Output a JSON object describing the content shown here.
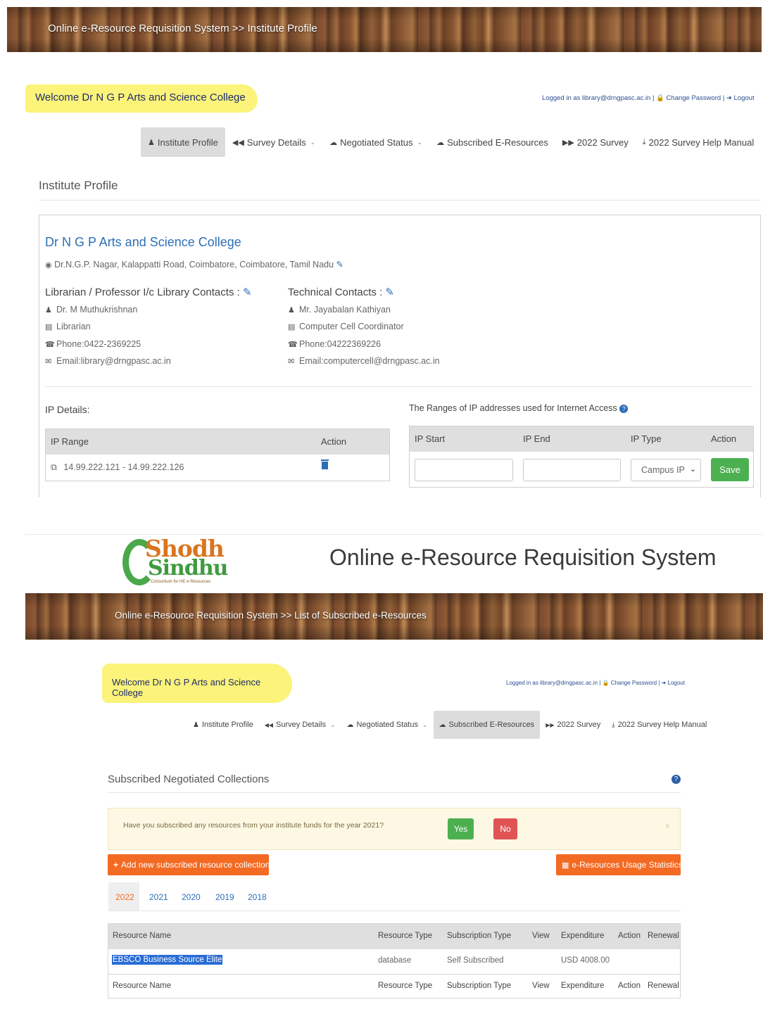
{
  "top": {
    "breadcrumb": "Online e-Resource Requisition System >> Institute Profile",
    "welcome": "Welcome Dr N G P Arts and Science College",
    "logged_in": "Logged in as library@drngpasc.ac.in | 🔒 Change Password | ➜ Logout",
    "nav": [
      {
        "label": "Institute Profile",
        "icon": "user-icon"
      },
      {
        "label": "Survey Details",
        "icon": "backward-icon"
      },
      {
        "label": "Negotiated Status",
        "icon": "cloud-icon"
      },
      {
        "label": "Subscribed E-Resources",
        "icon": "cloud-icon"
      },
      {
        "label": "2022 Survey",
        "icon": "forward-icon"
      },
      {
        "label": "2022 Survey Help Manual",
        "icon": "download-icon"
      }
    ],
    "section_title": "Institute Profile",
    "college_name": "Dr N G P Arts and Science College",
    "address": "Dr.N.G.P. Nagar, Kalappatti Road, Coimbatore, Coimbatore, Tamil Nadu",
    "librarian": {
      "heading": "Librarian / Professor I/c Library Contacts :",
      "name": "Dr. M Muthukrishnan",
      "designation": "Librarian",
      "phone": "Phone:0422-2369225",
      "email": "Email:library@drngpasc.ac.in"
    },
    "technical": {
      "heading": "Technical Contacts :",
      "name": "Mr. Jayabalan Kathiyan",
      "designation": "Computer Cell Coordinator",
      "phone": "Phone:04222369226",
      "email": "Email:computercell@drngpasc.ac.in"
    },
    "ip_details_label": "IP Details:",
    "ip_ranges_label": "The Ranges of IP addresses used for Internet Access",
    "ip_table": {
      "headers": [
        "IP Range",
        "Action"
      ],
      "rows": [
        {
          "range": "14.99.222.121 - 14.99.222.126"
        }
      ]
    },
    "ip_form": {
      "headers": [
        "IP Start",
        "IP End",
        "IP Type",
        "Action"
      ],
      "ip_type_value": "Campus IP",
      "save_label": "Save"
    }
  },
  "bottom": {
    "logo_text_1": "Shodh",
    "logo_text_2": "Sindhu",
    "logo_tagline": "Consortium for HE e-Resources",
    "system_title": "Online e-Resource Requisition System",
    "breadcrumb": "Online e-Resource Requisition System >> List of Subscribed e-Resources",
    "welcome": "Welcome Dr N G P Arts and Science College",
    "logged_in": "Logged in as library@drngpasc.ac.in | 🔒 Change Password | ➜ Logout",
    "nav": [
      {
        "label": "Institute Profile"
      },
      {
        "label": "Survey Details"
      },
      {
        "label": "Negotiated Status"
      },
      {
        "label": "Subscribed E-Resources"
      },
      {
        "label": "2022 Survey"
      },
      {
        "label": "2022 Survey Help Manual"
      }
    ],
    "section_title": "Subscribed Negotiated Collections",
    "alert_text": "Have you subscribed any resources from your institute funds for the year 2021?",
    "yes_label": "Yes",
    "no_label": "No",
    "add_button": "Add new subscribed resource collection",
    "stats_button": "e-Resources Usage Statistics",
    "years": [
      "2022",
      "2021",
      "2020",
      "2019",
      "2018"
    ],
    "table_headers": [
      "Resource Name",
      "Resource Type",
      "Subscription Type",
      "View",
      "Expenditure",
      "Action",
      "Renewal"
    ],
    "rows": [
      {
        "name": "EBSCO Business Source Elite",
        "type": "database",
        "subscription": "Self Subscribed",
        "expenditure": "USD 4008.00"
      }
    ]
  }
}
